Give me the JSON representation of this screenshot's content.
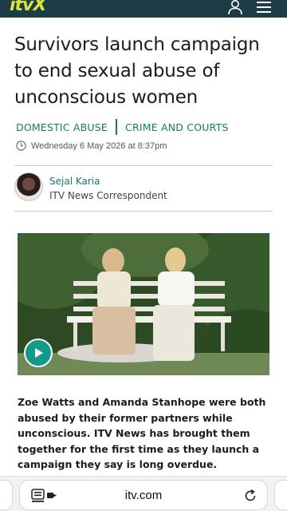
{
  "header": {
    "logo_text": "itvX",
    "user_icon": "user-icon",
    "menu_icon": "hamburger-menu-icon",
    "background_color": "#1f3b46",
    "logo_color": "#d6e639"
  },
  "article": {
    "headline": "Survivors launch campaign to end sexual abuse of unconscious women",
    "tags": [
      "DOMESTIC ABUSE",
      "CRIME AND COURTS"
    ],
    "date": "Wednesday 6 May 2026 at 8:37pm",
    "author": {
      "name": "Sejal Karia",
      "role": "ITV News Correspondent"
    },
    "video": {
      "play_icon": "play-icon"
    },
    "body": "Zoe Watts and Amanda Stanhope were both abused by their former partners while unconscious. ITV News has brought them together for the first time as they launch a campaign they say is long overdue."
  },
  "browser": {
    "url": "itv.com",
    "reader_icon": "reader-mode-icon",
    "reload_icon": "reload-icon"
  },
  "colors": {
    "accent": "#127a6b",
    "play_button": "#139a8a"
  }
}
